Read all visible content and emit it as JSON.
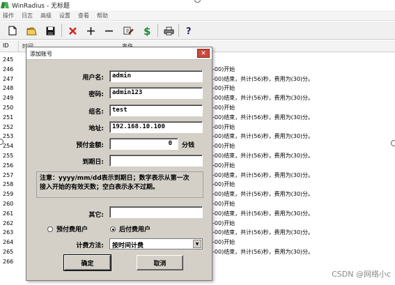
{
  "window": {
    "title": "WinRadius - 无标题"
  },
  "menu": [
    "操作",
    "日志",
    "高级",
    "设置",
    "查看",
    "帮助"
  ],
  "toolbar": {
    "icons": [
      "new-icon",
      "open-icon",
      "save-icon",
      "delete-icon",
      "add-icon",
      "remove-icon",
      "edit-icon",
      "dollar-icon",
      "print-icon",
      "help-icon"
    ]
  },
  "list": {
    "col_id": "ID",
    "col_time": "时间",
    "col_event": "事件",
    "ids": [
      "245",
      "246",
      "247",
      "248",
      "249",
      "250",
      "251",
      "252",
      "253",
      "254",
      "255",
      "256",
      "257",
      "258",
      "259",
      "260",
      "261",
      "262",
      "263",
      "264",
      "265",
      "266"
    ],
    "messages": [
      "",
      "-00)开始",
      "-00)结束，共计(56)秒，费用为(30)分。",
      "-00)开始",
      "-00)结束，共计(56)秒，费用为(30)分。",
      "-00)开始",
      "-00)结束，共计(56)秒，费用为(30)分。",
      "-00)开始",
      "-00)结束，共计(56)秒，费用为(30)分。",
      "-00)开始",
      "-00)结束，共计(56)秒，费用为(30)分。",
      "-00)开始",
      "-00)结束，共计(56)秒，费用为(30)分。",
      "-00)开始",
      "-00)结束，共计(56)秒，费用为(30)分。",
      "-00)开始",
      "-00)结束，共计(56)秒，费用为(30)分。",
      "-00)开始",
      "-00)结束，共计(56)秒，费用为(30)分。",
      "-00)开始",
      "-00)结束，共计(56)秒，费用为(30)分。",
      ""
    ]
  },
  "dialog": {
    "title": "添加账号",
    "username_label": "用户名:",
    "username_value": "admin",
    "password_label": "密码:",
    "password_value": "admin123",
    "group_label": "组名:",
    "group_value": "test",
    "address_label": "地址:",
    "address_value": "192.168.10.100",
    "prepay_label": "预付金额:",
    "prepay_value": "0",
    "prepay_unit": "分钱",
    "expiry_label": "到期日:",
    "expiry_value": "",
    "note_line1": "注意：yyyy/mm/dd表示到期日；数字表示从第一次",
    "note_line2": "接入开始的有效天数；空白表示永不过期。",
    "other_label": "其它:",
    "other_value": "",
    "radio_prepaid": "预付费用户",
    "radio_postpaid": "后付费用户",
    "postpaid_selected": true,
    "billing_label": "计费方法:",
    "billing_value": "按时间计费",
    "ok_label": "确定",
    "cancel_label": "取消"
  },
  "watermark": "CSDN @网络小c"
}
